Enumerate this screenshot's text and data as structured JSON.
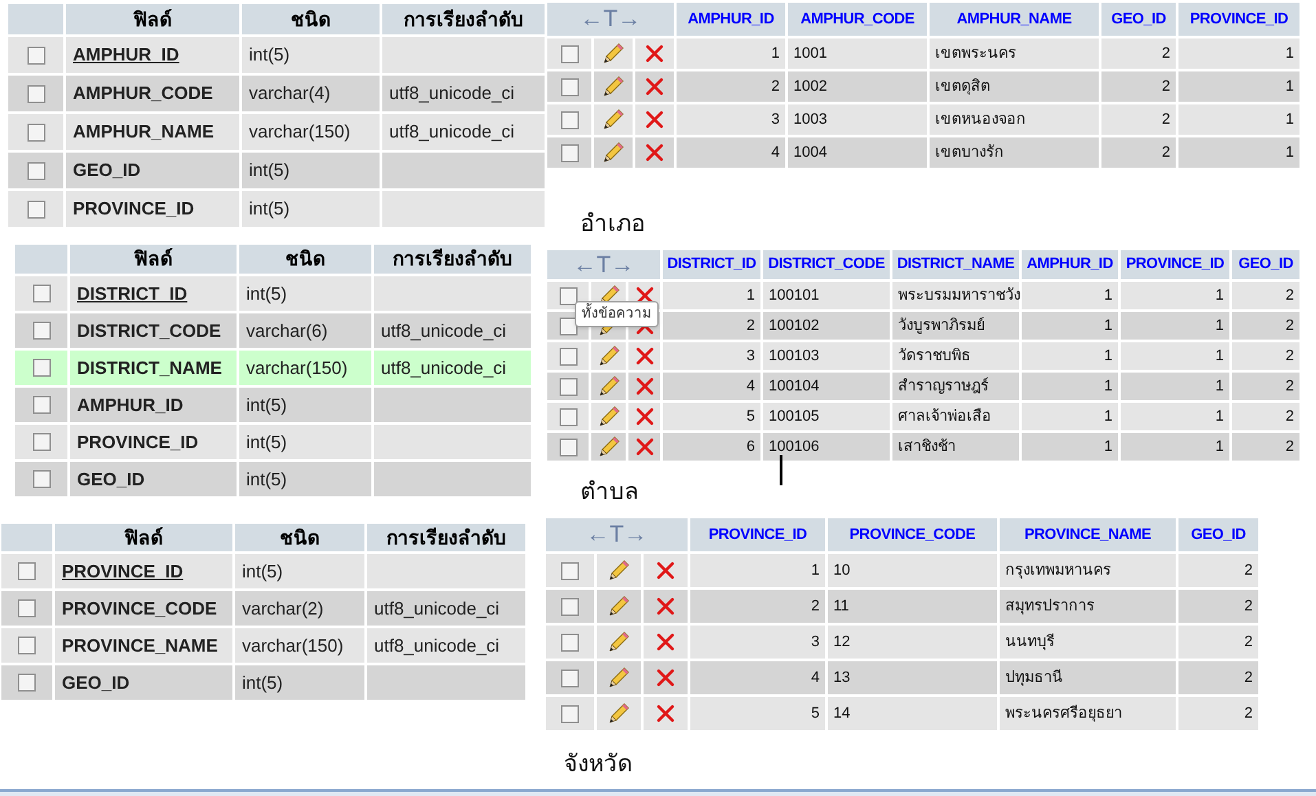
{
  "sections": [
    {
      "caption": "อำเภอ",
      "structure": {
        "columns": [
          "ฟิลด์",
          "ชนิด",
          "การเรียงลำดับ"
        ],
        "rows": [
          {
            "field": "AMPHUR_ID",
            "type": "int(5)",
            "collation": "",
            "primary": true,
            "highlighted": false,
            "checked": false
          },
          {
            "field": "AMPHUR_CODE",
            "type": "varchar(4)",
            "collation": "utf8_unicode_ci",
            "primary": false,
            "highlighted": false,
            "checked": false
          },
          {
            "field": "AMPHUR_NAME",
            "type": "varchar(150)",
            "collation": "utf8_unicode_ci",
            "primary": false,
            "highlighted": false,
            "checked": false
          },
          {
            "field": "GEO_ID",
            "type": "int(5)",
            "collation": "",
            "primary": false,
            "highlighted": false,
            "checked": false
          },
          {
            "field": "PROVINCE_ID",
            "type": "int(5)",
            "collation": "",
            "primary": false,
            "highlighted": false,
            "checked": false
          }
        ]
      },
      "data": {
        "action_header": "←T→",
        "columns": [
          {
            "label": "AMPHUR_ID",
            "kind": "number"
          },
          {
            "label": "AMPHUR_CODE",
            "kind": "text"
          },
          {
            "label": "AMPHUR_NAME",
            "kind": "text"
          },
          {
            "label": "GEO_ID",
            "kind": "number"
          },
          {
            "label": "PROVINCE_ID",
            "kind": "number"
          }
        ],
        "rows": [
          {
            "checked": false,
            "cells": [
              "1",
              "1001",
              "เขตพระนคร",
              "2",
              "1"
            ]
          },
          {
            "checked": false,
            "cells": [
              "2",
              "1002",
              "เขตดุสิต",
              "2",
              "1"
            ]
          },
          {
            "checked": false,
            "cells": [
              "3",
              "1003",
              "เขตหนองจอก",
              "2",
              "1"
            ]
          },
          {
            "checked": false,
            "cells": [
              "4",
              "1004",
              "เขตบางรัก",
              "2",
              "1"
            ]
          }
        ]
      }
    },
    {
      "caption": "ตำบล",
      "structure": {
        "columns": [
          "ฟิลด์",
          "ชนิด",
          "การเรียงลำดับ"
        ],
        "rows": [
          {
            "field": "DISTRICT_ID",
            "type": "int(5)",
            "collation": "",
            "primary": true,
            "highlighted": false,
            "checked": false
          },
          {
            "field": "DISTRICT_CODE",
            "type": "varchar(6)",
            "collation": "utf8_unicode_ci",
            "primary": false,
            "highlighted": false,
            "checked": false
          },
          {
            "field": "DISTRICT_NAME",
            "type": "varchar(150)",
            "collation": "utf8_unicode_ci",
            "primary": false,
            "highlighted": true,
            "checked": false
          },
          {
            "field": "AMPHUR_ID",
            "type": "int(5)",
            "collation": "",
            "primary": false,
            "highlighted": false,
            "checked": false
          },
          {
            "field": "PROVINCE_ID",
            "type": "int(5)",
            "collation": "",
            "primary": false,
            "highlighted": false,
            "checked": false
          },
          {
            "field": "GEO_ID",
            "type": "int(5)",
            "collation": "",
            "primary": false,
            "highlighted": false,
            "checked": false
          }
        ]
      },
      "data": {
        "action_header": "←T→",
        "tooltip": "ทั้งข้อความ",
        "columns": [
          {
            "label": "DISTRICT_ID",
            "kind": "number"
          },
          {
            "label": "DISTRICT_CODE",
            "kind": "text"
          },
          {
            "label": "DISTRICT_NAME",
            "kind": "text"
          },
          {
            "label": "AMPHUR_ID",
            "kind": "number"
          },
          {
            "label": "PROVINCE_ID",
            "kind": "number"
          },
          {
            "label": "GEO_ID",
            "kind": "number"
          }
        ],
        "rows": [
          {
            "checked": false,
            "cells": [
              "1",
              "100101",
              "พระบรมมหาราชวัง",
              "1",
              "1",
              "2"
            ]
          },
          {
            "checked": false,
            "cells": [
              "2",
              "100102",
              "วังบูรพาภิรมย์",
              "1",
              "1",
              "2"
            ]
          },
          {
            "checked": false,
            "cells": [
              "3",
              "100103",
              "วัดราชบพิธ",
              "1",
              "1",
              "2"
            ]
          },
          {
            "checked": false,
            "cells": [
              "4",
              "100104",
              "สำราญราษฎร์",
              "1",
              "1",
              "2"
            ]
          },
          {
            "checked": false,
            "cells": [
              "5",
              "100105",
              "ศาลเจ้าพ่อเสือ",
              "1",
              "1",
              "2"
            ]
          },
          {
            "checked": false,
            "cells": [
              "6",
              "100106",
              "เสาชิงช้า",
              "1",
              "1",
              "2"
            ]
          }
        ]
      }
    },
    {
      "caption": "จังหวัด",
      "structure": {
        "columns": [
          "ฟิลด์",
          "ชนิด",
          "การเรียงลำดับ"
        ],
        "rows": [
          {
            "field": "PROVINCE_ID",
            "type": "int(5)",
            "collation": "",
            "primary": true,
            "highlighted": false,
            "checked": false
          },
          {
            "field": "PROVINCE_CODE",
            "type": "varchar(2)",
            "collation": "utf8_unicode_ci",
            "primary": false,
            "highlighted": false,
            "checked": false
          },
          {
            "field": "PROVINCE_NAME",
            "type": "varchar(150)",
            "collation": "utf8_unicode_ci",
            "primary": false,
            "highlighted": false,
            "checked": false
          },
          {
            "field": "GEO_ID",
            "type": "int(5)",
            "collation": "",
            "primary": false,
            "highlighted": false,
            "checked": false
          }
        ]
      },
      "data": {
        "action_header": "←T→",
        "columns": [
          {
            "label": "PROVINCE_ID",
            "kind": "number"
          },
          {
            "label": "PROVINCE_CODE",
            "kind": "text"
          },
          {
            "label": "PROVINCE_NAME",
            "kind": "text"
          },
          {
            "label": "GEO_ID",
            "kind": "number"
          }
        ],
        "rows": [
          {
            "checked": false,
            "cells": [
              "1",
              "10",
              "กรุงเทพมหานคร",
              "2"
            ]
          },
          {
            "checked": false,
            "cells": [
              "2",
              "11",
              "สมุทรปราการ",
              "2"
            ]
          },
          {
            "checked": false,
            "cells": [
              "3",
              "12",
              "นนทบุรี",
              "2"
            ]
          },
          {
            "checked": false,
            "cells": [
              "4",
              "13",
              "ปทุมธานี",
              "2"
            ]
          },
          {
            "checked": false,
            "cells": [
              "5",
              "14",
              "พระนครศรีอยุธยา",
              "2"
            ]
          }
        ]
      }
    }
  ]
}
